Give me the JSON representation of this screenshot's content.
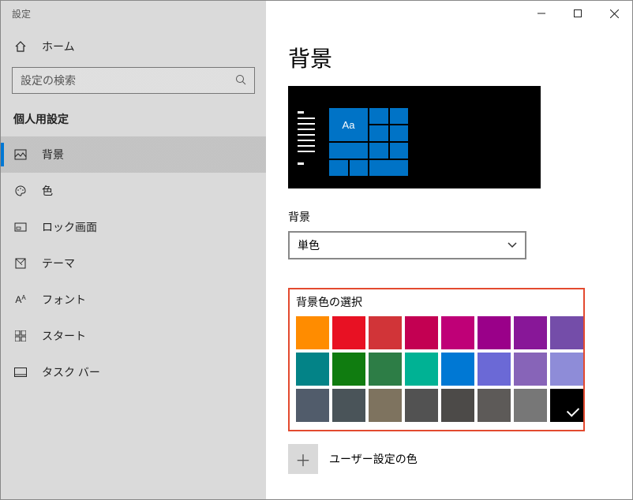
{
  "window": {
    "title": "設定"
  },
  "sidebar": {
    "home": "ホーム",
    "search_placeholder": "設定の検索",
    "section": "個人用設定",
    "items": [
      {
        "label": "背景"
      },
      {
        "label": "色"
      },
      {
        "label": "ロック画面"
      },
      {
        "label": "テーマ"
      },
      {
        "label": "フォント"
      },
      {
        "label": "スタート"
      },
      {
        "label": "タスク バー"
      }
    ]
  },
  "main": {
    "title": "背景",
    "preview_tile_text": "Aa",
    "background_label": "背景",
    "background_value": "単色",
    "color_section_label": "背景色の選択",
    "colors": [
      "#ff8c00",
      "#e81123",
      "#d13438",
      "#c30052",
      "#bf0077",
      "#9a0089",
      "#881798",
      "#744da9",
      "#038387",
      "#107c10",
      "#2d7d46",
      "#00b294",
      "#0078d4",
      "#6b69d6",
      "#8764b8",
      "#8e8cd8",
      "#515c6b",
      "#4a5459",
      "#7e735f",
      "#525252",
      "#4c4a48",
      "#5d5a58",
      "#777777",
      "#000000"
    ],
    "selected_color_index": 23,
    "custom_color_label": "ユーザー設定の色"
  }
}
